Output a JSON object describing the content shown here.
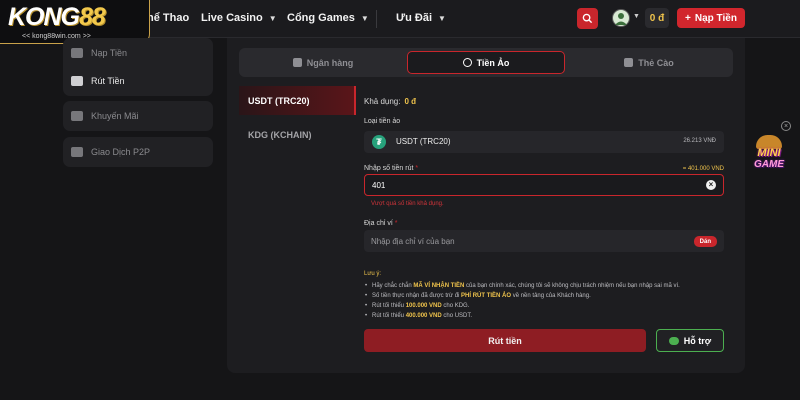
{
  "logo": {
    "brand": "KONG",
    "brand_num": "88",
    "url": "<< kong88win.com >>"
  },
  "nav": {
    "items": [
      {
        "label": "hể Thao",
        "has_chevron": false
      },
      {
        "label": "Live Casino",
        "has_chevron": true
      },
      {
        "label": "Cổng Games",
        "has_chevron": true
      },
      {
        "label": "Ưu Đãi",
        "has_chevron": true
      }
    ],
    "balance": "0 đ",
    "deposit_label": "Nạp Tiền",
    "search_icon": "search-icon",
    "user_icon": "avatar-icon"
  },
  "sidebar": {
    "items": [
      {
        "label": "Nạp Tiền",
        "icon": "deposit-icon",
        "dim": true
      },
      {
        "label": "Rút Tiền",
        "icon": "withdraw-icon",
        "dim": false
      },
      {
        "label": "Khuyến Mãi",
        "icon": "gift-icon",
        "dim": true
      },
      {
        "label": "Giao Dịch P2P",
        "icon": "exchange-icon",
        "dim": true
      }
    ]
  },
  "tabs": [
    {
      "label": "Ngân hàng",
      "icon": "bank-icon",
      "active": false
    },
    {
      "label": "Tiền Ảo",
      "icon": "crypto-icon",
      "active": true
    },
    {
      "label": "Thẻ Cào",
      "icon": "card-icon",
      "active": false
    }
  ],
  "coins": [
    {
      "label": "USDT (TRC20)",
      "active": true
    },
    {
      "label": "KDG (KCHAIN)",
      "active": false
    }
  ],
  "form": {
    "available_label": "Khả dụng:",
    "available_value": "0 đ",
    "coin_type_label": "Loại tiền ảo",
    "coin_name": "USDT (TRC20)",
    "coin_rate": "26.213 VNĐ",
    "amount_label": "Nhập số tiền rút",
    "amount_converted": "= 401.000 VND",
    "amount_value": "401",
    "amount_error": "Vượt quá số tiền khả dụng.",
    "address_label": "Địa chỉ ví",
    "address_placeholder": "Nhập địa chỉ ví của bạn",
    "paste_label": "Dán",
    "note_title": "Lưu ý:",
    "notes": [
      {
        "pre": "Hãy chắc chắn ",
        "bold": "MÃ VÍ NHẬN TIỀN",
        "post": " của bạn chính xác, chúng tôi sẽ không chịu trách nhiệm nếu bạn nhập sai mã ví."
      },
      {
        "pre": "Số tiền thực nhận đã được trừ đi ",
        "bold": "PHÍ RÚT TIỀN ẢO",
        "post": " về nền tảng của Khách hàng."
      },
      {
        "pre": "Rút tối thiểu ",
        "bold": "100.000 VND",
        "post": " cho KDG."
      },
      {
        "pre": "Rút tối thiểu ",
        "bold": "400.000 VND",
        "post": " cho USDT."
      }
    ],
    "withdraw_label": "Rút tiền",
    "support_label": "Hỗ trợ"
  },
  "mini_game": {
    "line1": "MINI",
    "line2": "GAME",
    "close": "×"
  },
  "colors": {
    "accent": "#c9262c",
    "gold": "#f0c44c",
    "background": "#151517",
    "support": "#4caf50"
  }
}
